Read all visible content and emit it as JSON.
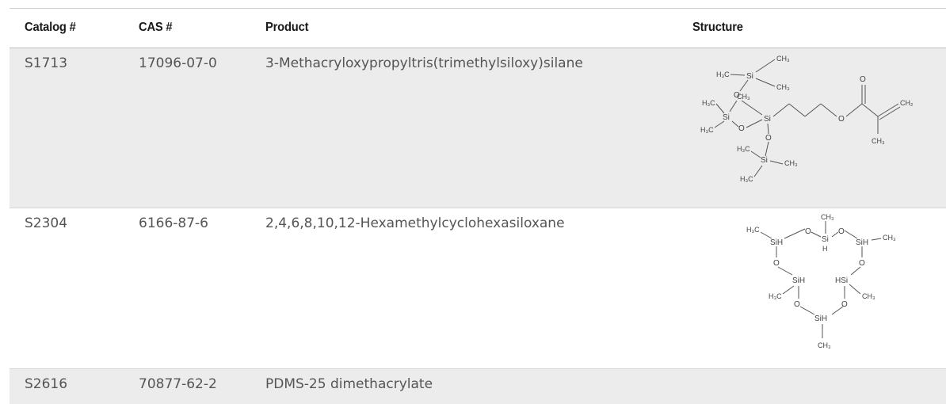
{
  "table": {
    "headers": {
      "catalog": "Catalog #",
      "cas": "CAS #",
      "product": "Product",
      "structure": "Structure"
    },
    "rows": [
      {
        "catalog": "S1713",
        "cas": "17096-07-0",
        "product": "3-Methacryloxypropyltris(trimethylsiloxy)silane"
      },
      {
        "catalog": "S2304",
        "cas": "6166-87-6",
        "product": "2,4,6,8,10,12-Hexamethylcyclohexasiloxane"
      },
      {
        "catalog": "S2616",
        "cas": "70877-62-2",
        "product": "PDMS-25 dimethacrylate"
      }
    ]
  },
  "colors": {
    "shaded_row": "#ececec",
    "body_text": "#555555",
    "header_text": "#1a1a1a"
  }
}
